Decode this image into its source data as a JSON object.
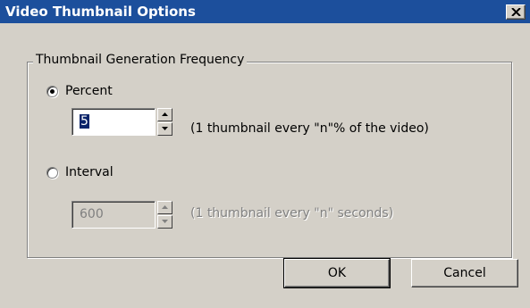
{
  "window": {
    "title": "Video Thumbnail Options",
    "close_symbol": "✕"
  },
  "group": {
    "label": "Thumbnail Generation Frequency"
  },
  "percent": {
    "label": "Percent",
    "selected": true,
    "value": "5",
    "hint": "(1 thumbnail every \"n\"% of the video)"
  },
  "interval": {
    "label": "Interval",
    "selected": false,
    "value": "600",
    "hint": "(1 thumbnail every \"n\" seconds)",
    "enabled": false
  },
  "buttons": {
    "ok": "OK",
    "cancel": "Cancel"
  },
  "icons": {
    "close": "close-icon",
    "spin_up": "arrow-up-icon",
    "spin_down": "arrow-down-icon"
  },
  "colors": {
    "titlebar": "#1c4f9c",
    "face": "#d4d0c8",
    "selection": "#0a246a"
  }
}
